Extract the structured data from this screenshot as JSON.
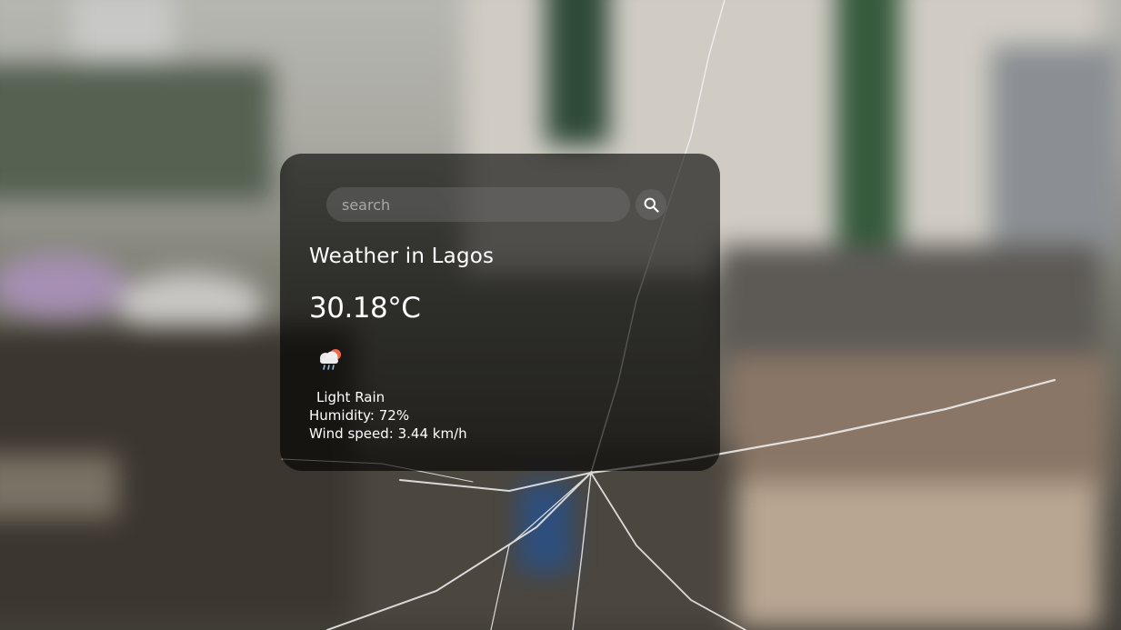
{
  "search": {
    "placeholder": "search",
    "value": "",
    "button_icon": "search-icon"
  },
  "weather": {
    "title": "Weather in Lagos",
    "temperature": "30.18°C",
    "icon": "rain-cloud-sun-icon",
    "description": "Light Rain",
    "humidity": "Humidity: 72%",
    "wind": "Wind speed: 3.44 km/h"
  },
  "colors": {
    "card_background": "rgba(0,0,0,0.62)",
    "text": "#ffffff",
    "placeholder": "#a8a8a8",
    "icon_sun": "#f06a4a",
    "icon_cloud": "#e8e8e8"
  }
}
